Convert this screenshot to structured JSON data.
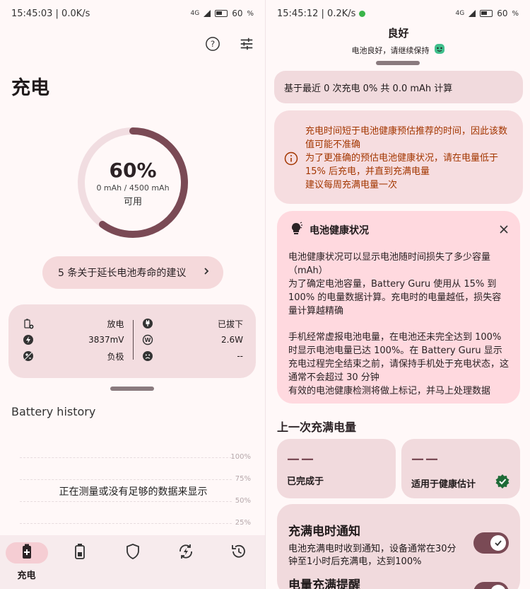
{
  "left": {
    "status": {
      "time": "15:45:03",
      "speed": "0.0K/s",
      "network": "4G",
      "battery": "60"
    },
    "title": "充电",
    "ring": {
      "percent": "60%",
      "percent_value": 0.6,
      "capacity": "0 mAh / 4500 mAh",
      "state": "可用"
    },
    "tips_button": "5 条关于延长电池寿命的建议",
    "stats": {
      "left": [
        {
          "icon": "battery-plus-icon",
          "value": "放电"
        },
        {
          "icon": "bolt-icon",
          "value": "3837mV"
        },
        {
          "icon": "polarity-icon",
          "value": "负极"
        }
      ],
      "right": [
        {
          "icon": "plug-icon",
          "value": "已拔下"
        },
        {
          "icon": "watt-icon",
          "value": "2.6W"
        },
        {
          "icon": "face-icon",
          "value": "--"
        }
      ]
    },
    "history": {
      "title": "Battery history",
      "no_data": "正在测量或没有足够的数据来显示",
      "ticks": [
        "100%",
        "75%",
        "50%",
        "25%"
      ]
    },
    "nav": [
      {
        "icon": "battery-charging-icon",
        "label": "充电",
        "active": true
      },
      {
        "icon": "battery-icon",
        "label": "",
        "active": false
      },
      {
        "icon": "shield-icon",
        "label": "",
        "active": false
      },
      {
        "icon": "cycle-bolt-icon",
        "label": "",
        "active": false
      },
      {
        "icon": "history-icon",
        "label": "",
        "active": false
      }
    ]
  },
  "right": {
    "status": {
      "time": "15:45:12",
      "speed": "0.2K/s",
      "network": "4G",
      "battery": "60"
    },
    "header": {
      "title": "良好",
      "subtitle": "电池良好，请继续保持"
    },
    "basis": "基于最近 0 次充电 0% 共 0.0 mAh 计算",
    "warning": [
      "充电时间短于电池健康预估推荐的时间，因此该数值可能不准确",
      "为了更准确的预估电池健康状况，请在电量低于 15% 后充电，并直到充满电量",
      "建议每周充满电量一次"
    ],
    "health": {
      "title": "电池健康状况",
      "para1": [
        "电池健康状况可以显示电池随时间损失了多少容量（mAh）",
        "为了确定电池容量，Battery Guru 使用从 15% 到 100% 的电量数据计算。充电时的电量越低，损失容量计算越精确"
      ],
      "para2": [
        "手机经常虚报电池电量，在电池还未完全达到 100% 时显示电池电量已达 100%。在 Battery Guru 显示充电过程完全结束之前，请保持手机处于充电状态，这通常不会超过 30 分钟",
        "有效的电池健康检测将做上标记，并马上处理数据"
      ]
    },
    "last_full": {
      "title": "上一次充满电量",
      "card_a": {
        "value": "——",
        "label": "已完成于"
      },
      "card_b": {
        "value": "——",
        "label": "适用于健康估计"
      }
    },
    "notify": {
      "title": "充满电时通知",
      "desc": "电池充满电时收到通知，设备通常在30分钟至1小时后充满电，达到100%",
      "toggle_on": true,
      "title2": "电量充满提醒"
    }
  },
  "colors": {
    "accent": "#7a4a55",
    "ring_track": "#f1dde1",
    "warning_text": "#a33600",
    "check": "#1e6b37"
  }
}
